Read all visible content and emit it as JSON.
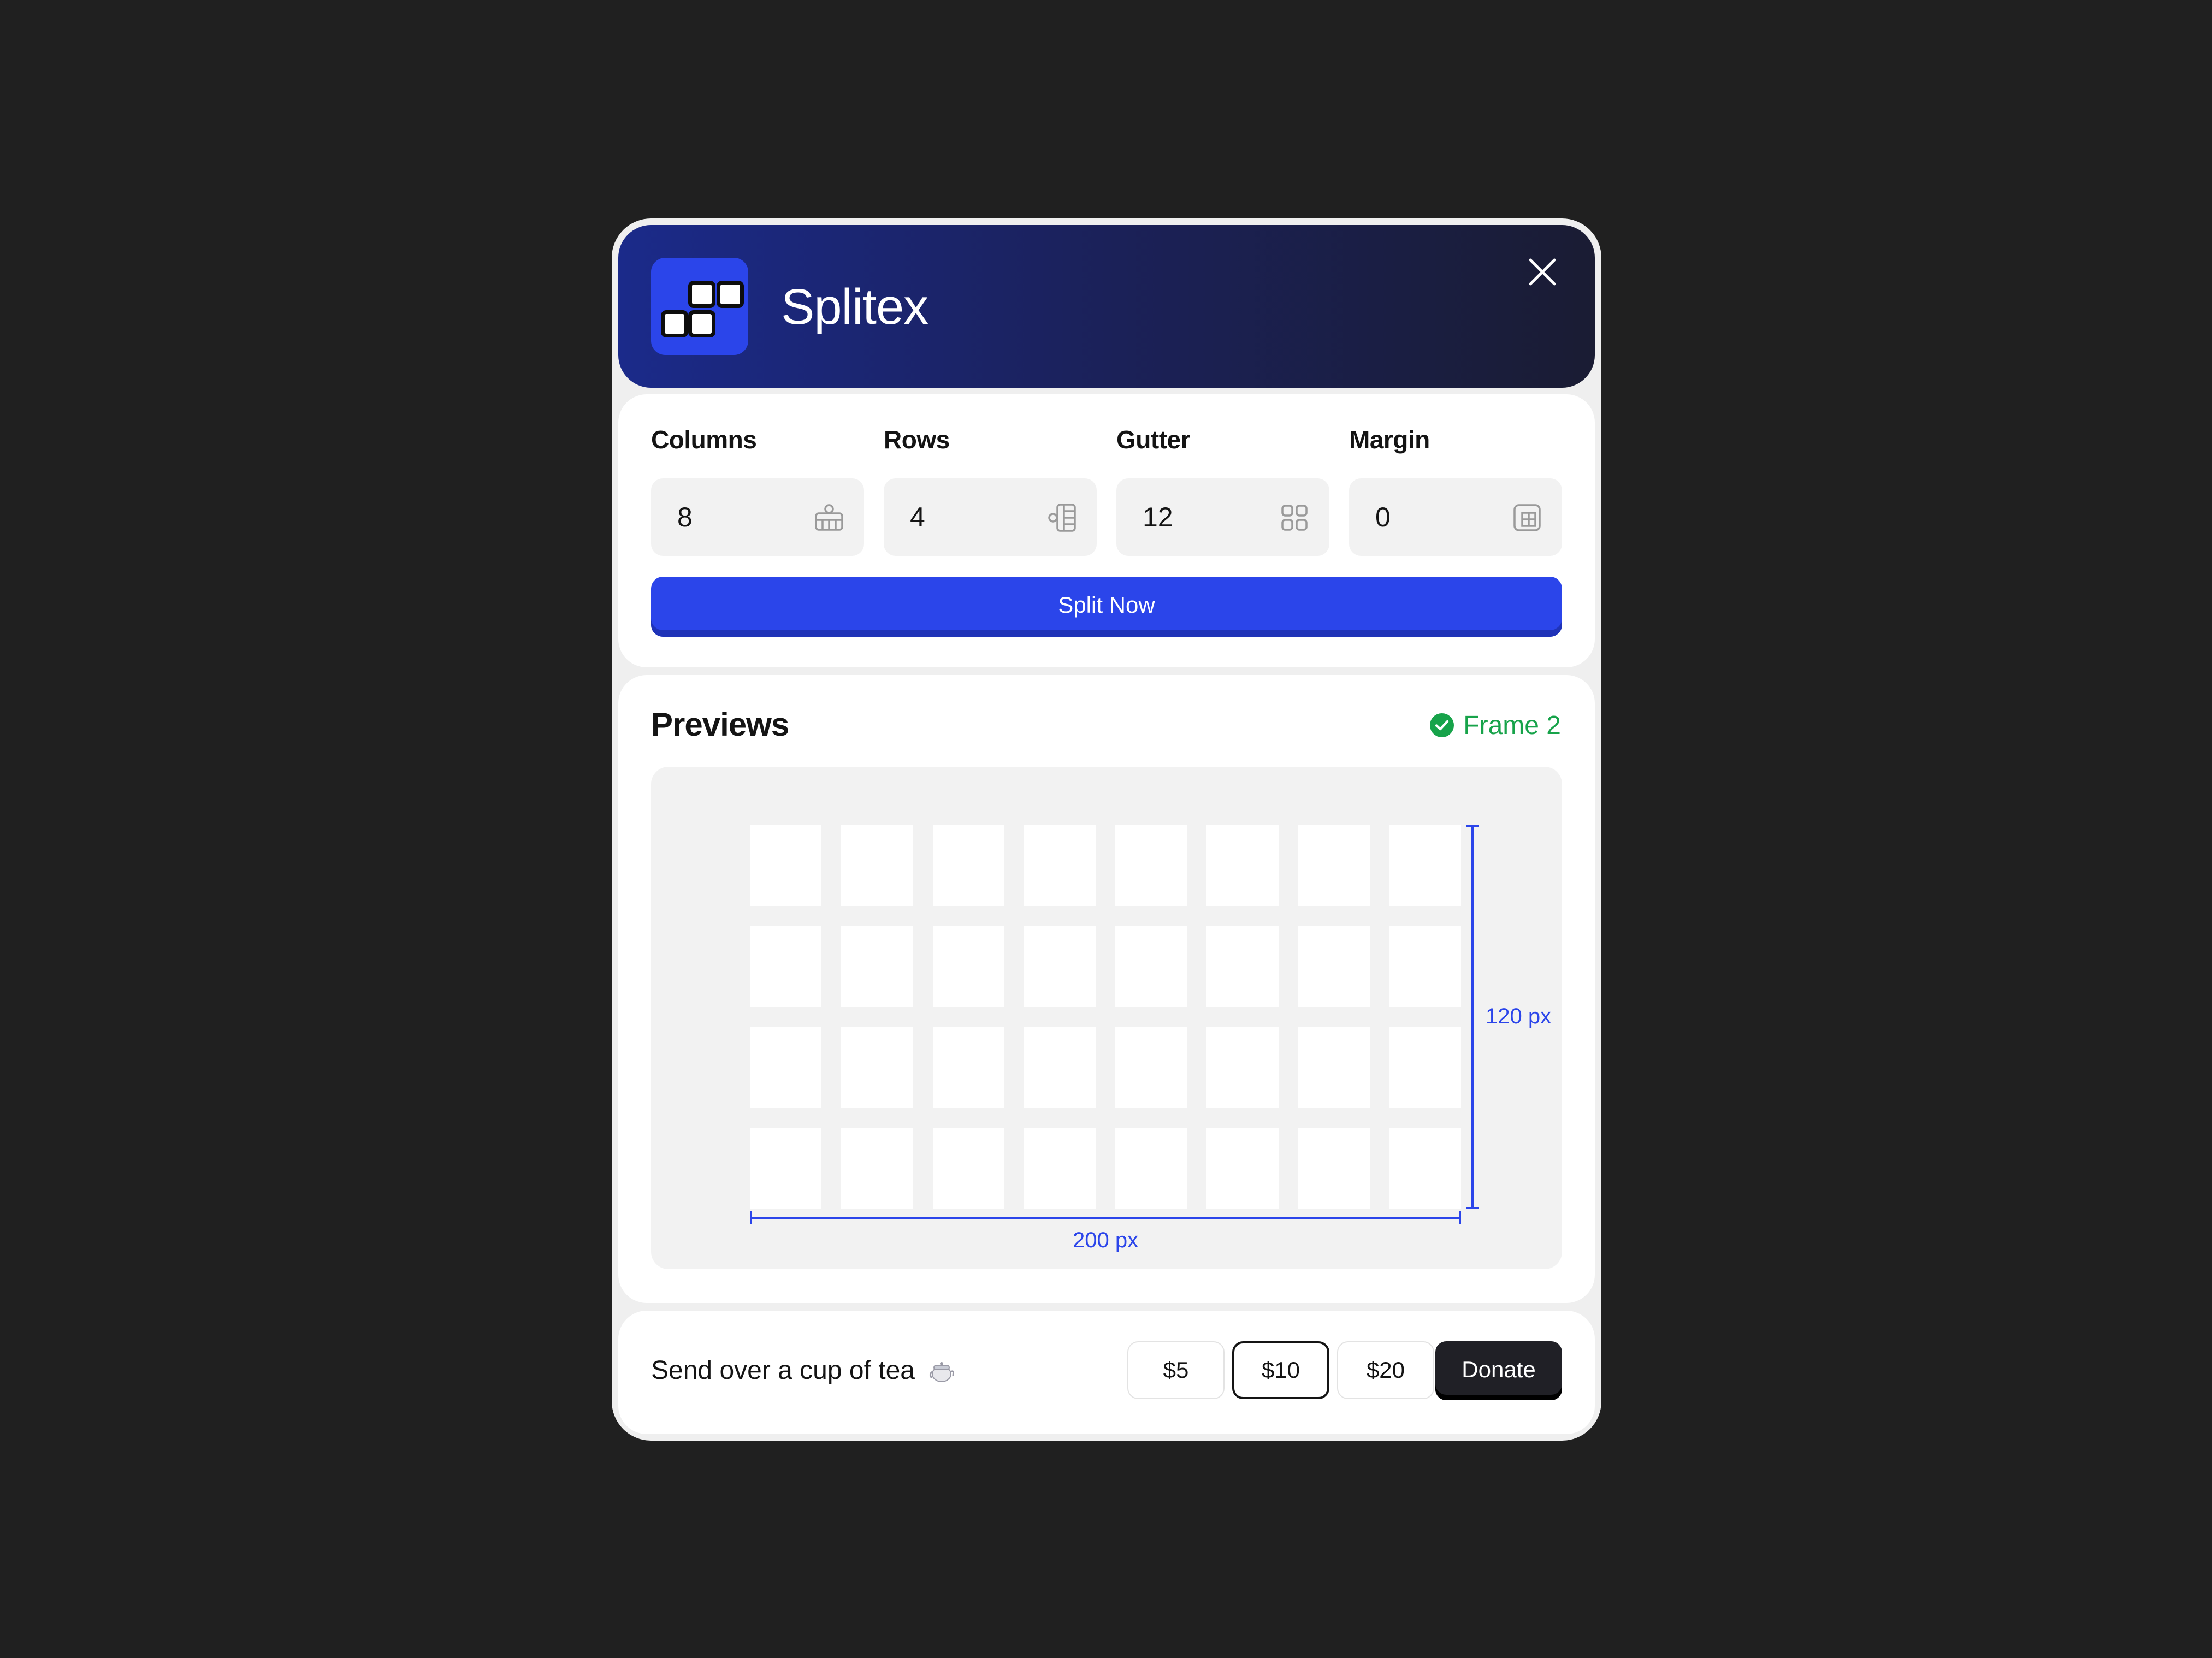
{
  "app": {
    "title": "Splitex",
    "close_icon": "close-icon",
    "logo_icon": "grid-squares-logo"
  },
  "settings": {
    "fields": [
      {
        "label": "Columns",
        "value": "8",
        "icon": "columns-icon"
      },
      {
        "label": "Rows",
        "value": "4",
        "icon": "rows-icon"
      },
      {
        "label": "Gutter",
        "value": "12",
        "icon": "gutter-grid-icon"
      },
      {
        "label": "Margin",
        "value": "0",
        "icon": "margin-layout-icon"
      }
    ],
    "split_label": "Split Now"
  },
  "previews": {
    "title": "Previews",
    "frame_label": "Frame 2",
    "frame_status_icon": "check-circle-icon",
    "width_label": "200 px",
    "height_label": "120 px",
    "grid": {
      "columns": 8,
      "rows": 4
    }
  },
  "footer": {
    "message": "Send over a cup of tea",
    "tea_icon": "teapot-icon",
    "amounts": [
      "$5",
      "$10",
      "$20"
    ],
    "selected_amount": "$10",
    "donate_label": "Donate"
  },
  "colors": {
    "accent": "#2b45ea",
    "success": "#17a34a",
    "background": "#202020",
    "dark_button": "#202026"
  }
}
